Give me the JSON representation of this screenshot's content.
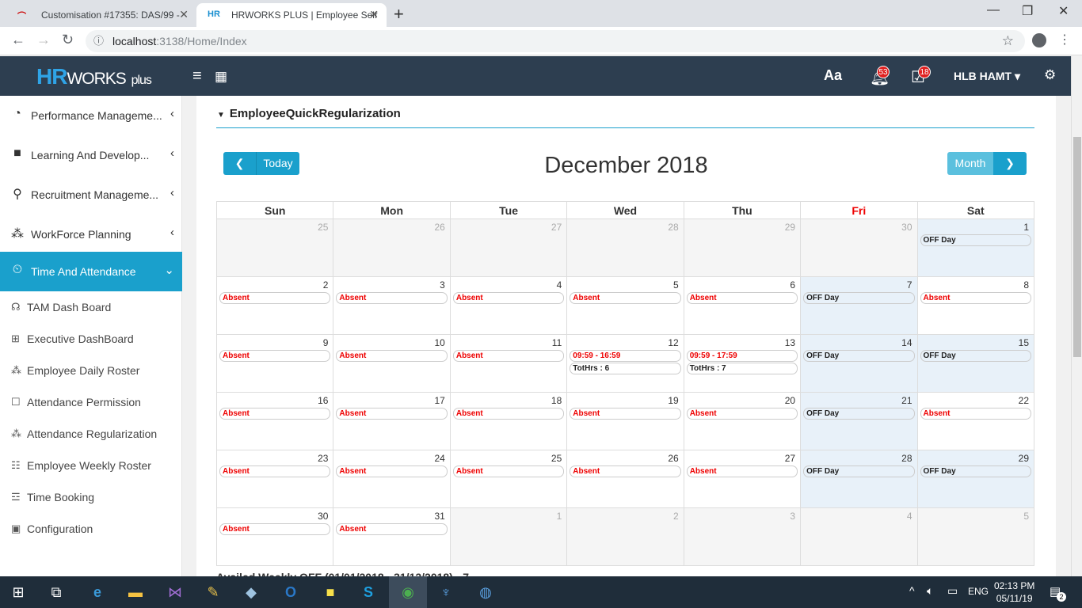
{
  "browser": {
    "tabs": [
      {
        "title": "Customisation #17355: DAS/99 -",
        "close": "✕"
      },
      {
        "title": "HRWORKS PLUS | Employee Self",
        "close": "✕"
      }
    ],
    "new_tab": "+",
    "url_host": "localhost",
    "url_path": ":3138/Home/Index",
    "window": {
      "minimize": "—",
      "maximize": "❐",
      "close": "✕"
    }
  },
  "header": {
    "logo_hr": "HR",
    "logo_works": "WORKS",
    "logo_plus": "plus",
    "font_icon": "Aa",
    "notif_count": "53",
    "calendar_count": "18",
    "user": "HLB HAMT"
  },
  "sidebar": {
    "items": [
      {
        "label": "Performance Manageme...",
        "icon": "gauge-icon"
      },
      {
        "label": "Learning And Develop...",
        "icon": "book-icon"
      },
      {
        "label": "Recruitment Manageme...",
        "icon": "recruit-icon"
      },
      {
        "label": "WorkForce Planning",
        "icon": "people-icon"
      },
      {
        "label": "Time And Attendance",
        "icon": "clock-icon"
      }
    ],
    "subitems": [
      {
        "label": "TAM Dash Board"
      },
      {
        "label": "Executive DashBoard"
      },
      {
        "label": "Employee Daily Roster"
      },
      {
        "label": "Attendance Permission"
      },
      {
        "label": "Attendance Regularization"
      },
      {
        "label": "Employee Weekly Roster"
      },
      {
        "label": "Time Booking"
      },
      {
        "label": "Configuration"
      }
    ]
  },
  "panel": {
    "title": "EmployeeQuickRegularization",
    "today": "Today",
    "month": "Month",
    "cal_title": "December 2018",
    "footer_note": "Availed Weekly OFF (01/01/2018 - 31/12/2018) - 7"
  },
  "calendar": {
    "weekdays": [
      "Sun",
      "Mon",
      "Tue",
      "Wed",
      "Thu",
      "Fri",
      "Sat"
    ],
    "weeks": [
      [
        {
          "d": "25",
          "other": true,
          "ev": []
        },
        {
          "d": "26",
          "other": true,
          "ev": []
        },
        {
          "d": "27",
          "other": true,
          "ev": []
        },
        {
          "d": "28",
          "other": true,
          "ev": []
        },
        {
          "d": "29",
          "other": true,
          "ev": []
        },
        {
          "d": "30",
          "other": true,
          "ev": []
        },
        {
          "d": "1",
          "off": true,
          "ev": [
            {
              "t": "OFF Day",
              "k": "offd"
            }
          ]
        }
      ],
      [
        {
          "d": "2",
          "ev": [
            {
              "t": "Absent",
              "k": "abs"
            }
          ]
        },
        {
          "d": "3",
          "ev": [
            {
              "t": "Absent",
              "k": "abs"
            }
          ]
        },
        {
          "d": "4",
          "ev": [
            {
              "t": "Absent",
              "k": "abs"
            }
          ]
        },
        {
          "d": "5",
          "ev": [
            {
              "t": "Absent",
              "k": "abs"
            }
          ]
        },
        {
          "d": "6",
          "ev": [
            {
              "t": "Absent",
              "k": "abs"
            }
          ]
        },
        {
          "d": "7",
          "off": true,
          "ev": [
            {
              "t": "OFF Day",
              "k": "offd"
            }
          ]
        },
        {
          "d": "8",
          "ev": [
            {
              "t": "Absent",
              "k": "abs"
            }
          ]
        }
      ],
      [
        {
          "d": "9",
          "ev": [
            {
              "t": "Absent",
              "k": "abs"
            }
          ]
        },
        {
          "d": "10",
          "ev": [
            {
              "t": "Absent",
              "k": "abs"
            }
          ]
        },
        {
          "d": "11",
          "ev": [
            {
              "t": "Absent",
              "k": "abs"
            }
          ]
        },
        {
          "d": "12",
          "ev": [
            {
              "t": "09:59 - 16:59",
              "k": "time"
            },
            {
              "t": "TotHrs : 6",
              "k": "tot"
            }
          ]
        },
        {
          "d": "13",
          "ev": [
            {
              "t": "09:59 - 17:59",
              "k": "time"
            },
            {
              "t": "TotHrs : 7",
              "k": "tot"
            }
          ]
        },
        {
          "d": "14",
          "off": true,
          "ev": [
            {
              "t": "OFF Day",
              "k": "offd"
            }
          ]
        },
        {
          "d": "15",
          "off": true,
          "ev": [
            {
              "t": "OFF Day",
              "k": "offd"
            }
          ]
        }
      ],
      [
        {
          "d": "16",
          "ev": [
            {
              "t": "Absent",
              "k": "abs"
            }
          ]
        },
        {
          "d": "17",
          "ev": [
            {
              "t": "Absent",
              "k": "abs"
            }
          ]
        },
        {
          "d": "18",
          "ev": [
            {
              "t": "Absent",
              "k": "abs"
            }
          ]
        },
        {
          "d": "19",
          "ev": [
            {
              "t": "Absent",
              "k": "abs"
            }
          ]
        },
        {
          "d": "20",
          "ev": [
            {
              "t": "Absent",
              "k": "abs"
            }
          ]
        },
        {
          "d": "21",
          "off": true,
          "ev": [
            {
              "t": "OFF Day",
              "k": "offd"
            }
          ]
        },
        {
          "d": "22",
          "ev": [
            {
              "t": "Absent",
              "k": "abs"
            }
          ]
        }
      ],
      [
        {
          "d": "23",
          "ev": [
            {
              "t": "Absent",
              "k": "abs"
            }
          ]
        },
        {
          "d": "24",
          "ev": [
            {
              "t": "Absent",
              "k": "abs"
            }
          ]
        },
        {
          "d": "25",
          "ev": [
            {
              "t": "Absent",
              "k": "abs"
            }
          ]
        },
        {
          "d": "26",
          "ev": [
            {
              "t": "Absent",
              "k": "abs"
            }
          ]
        },
        {
          "d": "27",
          "ev": [
            {
              "t": "Absent",
              "k": "abs"
            }
          ]
        },
        {
          "d": "28",
          "off": true,
          "ev": [
            {
              "t": "OFF Day",
              "k": "offd"
            }
          ]
        },
        {
          "d": "29",
          "off": true,
          "ev": [
            {
              "t": "OFF Day",
              "k": "offd"
            }
          ]
        }
      ],
      [
        {
          "d": "30",
          "ev": [
            {
              "t": "Absent",
              "k": "abs"
            }
          ]
        },
        {
          "d": "31",
          "ev": [
            {
              "t": "Absent",
              "k": "abs"
            }
          ]
        },
        {
          "d": "1",
          "other": true,
          "ev": []
        },
        {
          "d": "2",
          "other": true,
          "ev": []
        },
        {
          "d": "3",
          "other": true,
          "ev": []
        },
        {
          "d": "4",
          "other": true,
          "ev": []
        },
        {
          "d": "5",
          "other": true,
          "ev": []
        }
      ]
    ]
  },
  "taskbar": {
    "lang": "ENG",
    "time": "02:13 PM",
    "date": "05/11/19",
    "notif": "2"
  }
}
